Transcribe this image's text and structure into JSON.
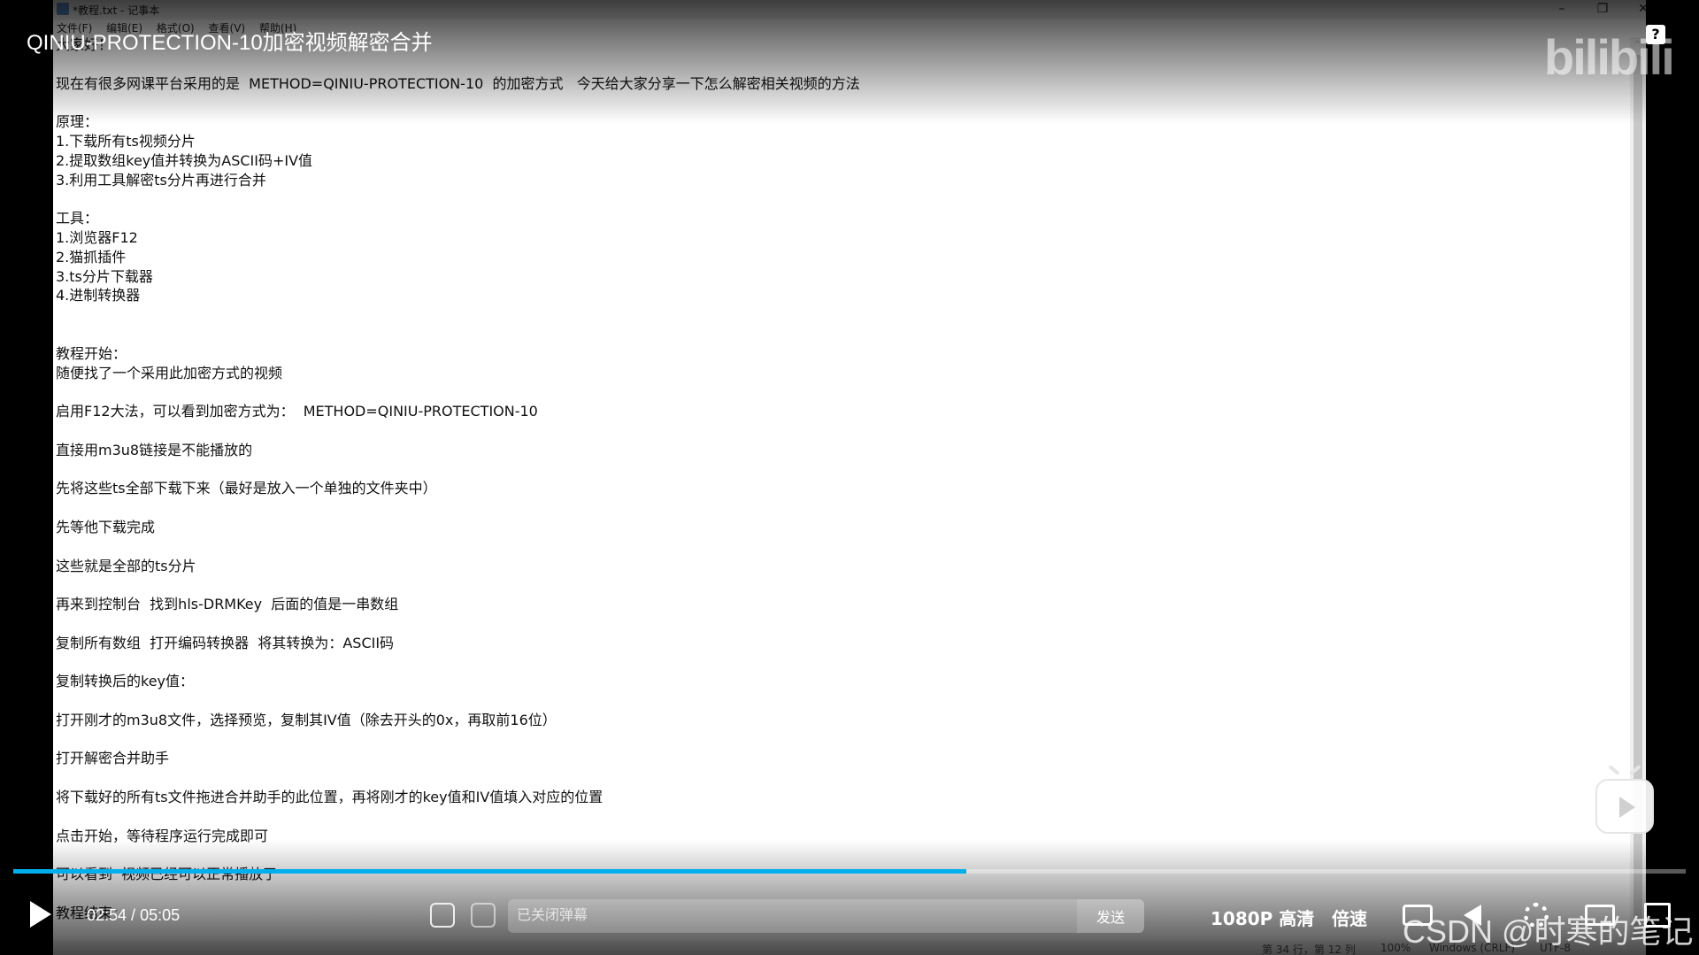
{
  "notepad": {
    "window_title": "*教程.txt - 记事本",
    "menu": [
      "文件(F)",
      "编辑(E)",
      "格式(O)",
      "查看(V)",
      "帮助(H)"
    ],
    "lines": [
      "大家好！",
      "",
      "现在有很多网课平台采用的是  METHOD=QINIU-PROTECTION-10  的加密方式   今天给大家分享一下怎么解密相关视频的方法",
      "",
      "原理：",
      "1.下载所有ts视频分片",
      "2.提取数组key值并转换为ASCII码+IV值",
      "3.利用工具解密ts分片再进行合并",
      "",
      "工具：",
      "1.浏览器F12",
      "2.猫抓插件",
      "3.ts分片下载器",
      "4.进制转换器",
      "",
      "",
      "教程开始：",
      "随便找了一个采用此加密方式的视频",
      "",
      "启用F12大法，可以看到加密方式为：  METHOD=QINIU-PROTECTION-10",
      "",
      "直接用m3u8链接是不能播放的",
      "",
      "先将这些ts全部下载下来（最好是放入一个单独的文件夹中）",
      "",
      "先等他下载完成",
      "",
      "这些就是全部的ts分片",
      "",
      "再来到控制台  找到hls-DRMKey  后面的值是一串数组",
      "",
      "复制所有数组  打开编码转换器  将其转换为：ASCII码",
      "",
      "复制转换后的key值：",
      "",
      "打开刚才的m3u8文件，选择预览，复制其IV值（除去开头的0x，再取前16位）",
      "",
      "打开解密合并助手",
      "",
      "将下载好的所有ts文件拖进合并助手的此位置，再将刚才的key值和IV值填入对应的位置",
      "",
      "点击开始，等待程序运行完成即可",
      "",
      "可以看到  视频已经可以正常播放了",
      "",
      "教程结束："
    ],
    "status": {
      "position": "第 34 行，第 12 列",
      "zoom": "100%",
      "line_ending": "Windows (CRLF)",
      "encoding": "UTF-8"
    }
  },
  "player": {
    "video_title": "QINIU-PROTECTION-10加密视频解密合并",
    "logo_text": "bilibili",
    "help_label": "?",
    "time_current": "02:54",
    "time_separator": " / ",
    "time_total": "05:05",
    "progress_fraction": 0.57,
    "danmaku_placeholder": "已关闭弹幕",
    "send_label": "发送",
    "quality_label": "1080P 高清",
    "speed_label": "倍速",
    "accent_color": "#00aeec"
  },
  "watermark": "CSDN @时寒的笔记",
  "icons": [
    "danmaku-toggle-icon",
    "danmaku-settings-icon",
    "subtitle-icon",
    "volume-icon",
    "settings-icon",
    "pip-icon",
    "fullscreen-icon",
    "mini-player-icon",
    "play-icon"
  ]
}
